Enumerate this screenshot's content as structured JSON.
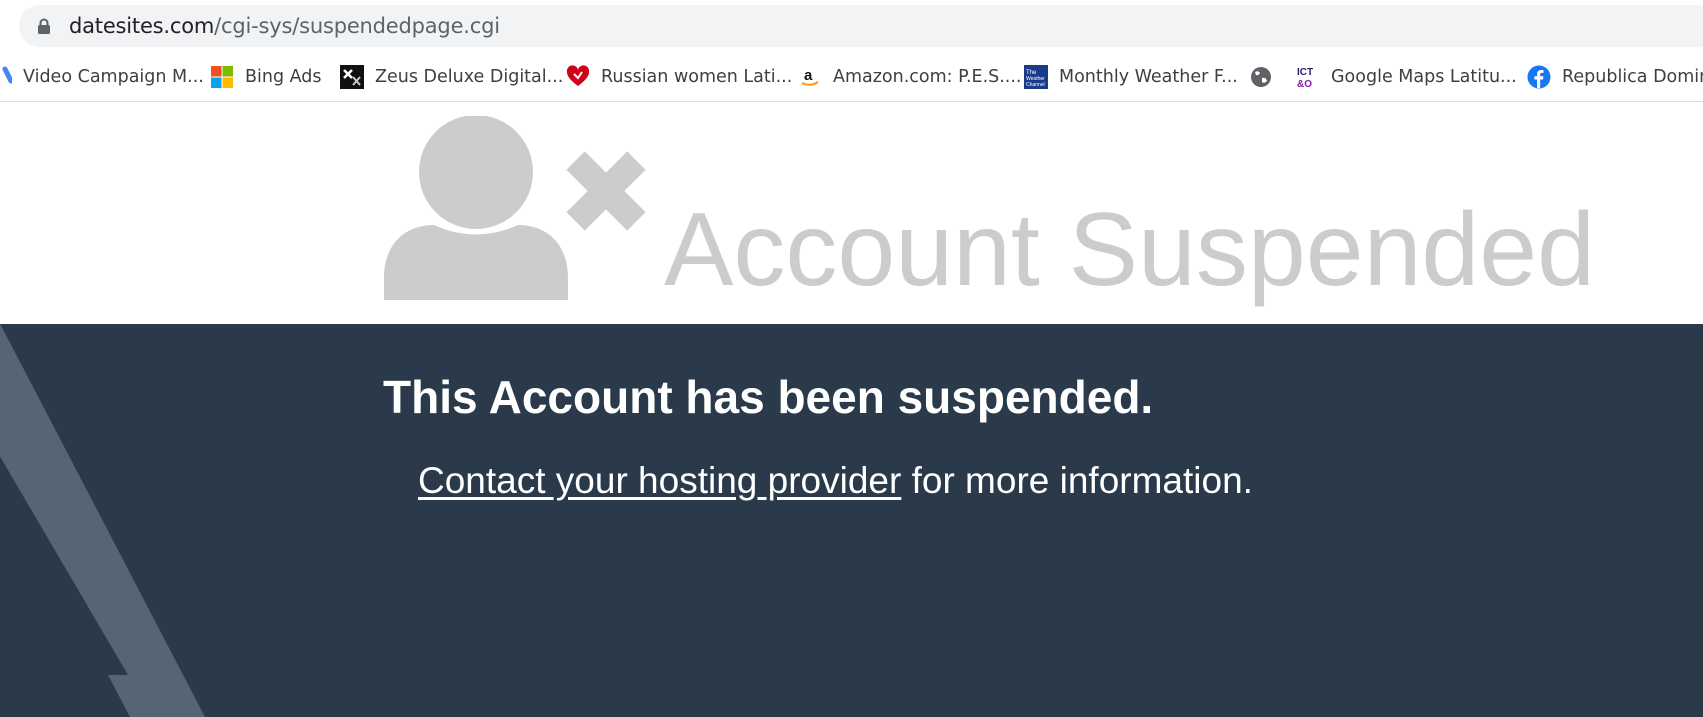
{
  "address_bar": {
    "host": "datesites.com",
    "path": "/cgi-sys/suspendedpage.cgi"
  },
  "bookmarks": [
    {
      "label": "Video Campaign M...",
      "icon": "google-ads-icon"
    },
    {
      "label": "Bing Ads",
      "icon": "microsoft-icon"
    },
    {
      "label": "Zeus Deluxe Digital...",
      "icon": "zeus-icon"
    },
    {
      "label": "Russian women Lati...",
      "icon": "heart-icon"
    },
    {
      "label": "Amazon.com: P.E.S....",
      "icon": "amazon-icon"
    },
    {
      "label": "Monthly Weather F...",
      "icon": "weather-channel-icon"
    },
    {
      "label": "",
      "icon": "globe-icon"
    },
    {
      "label": "Google Maps Latitu...",
      "icon": "ict-icon"
    },
    {
      "label": "Republica Domini",
      "icon": "facebook-icon"
    }
  ],
  "page": {
    "title": "Account Suspended",
    "headline": "This Account has been suspended.",
    "contact_link": "Contact your hosting provider",
    "info_suffix": " for more information."
  },
  "colors": {
    "dark_background": "#2a3a4b",
    "title_gray": "#cccccc",
    "shape_gray": "#566574"
  }
}
